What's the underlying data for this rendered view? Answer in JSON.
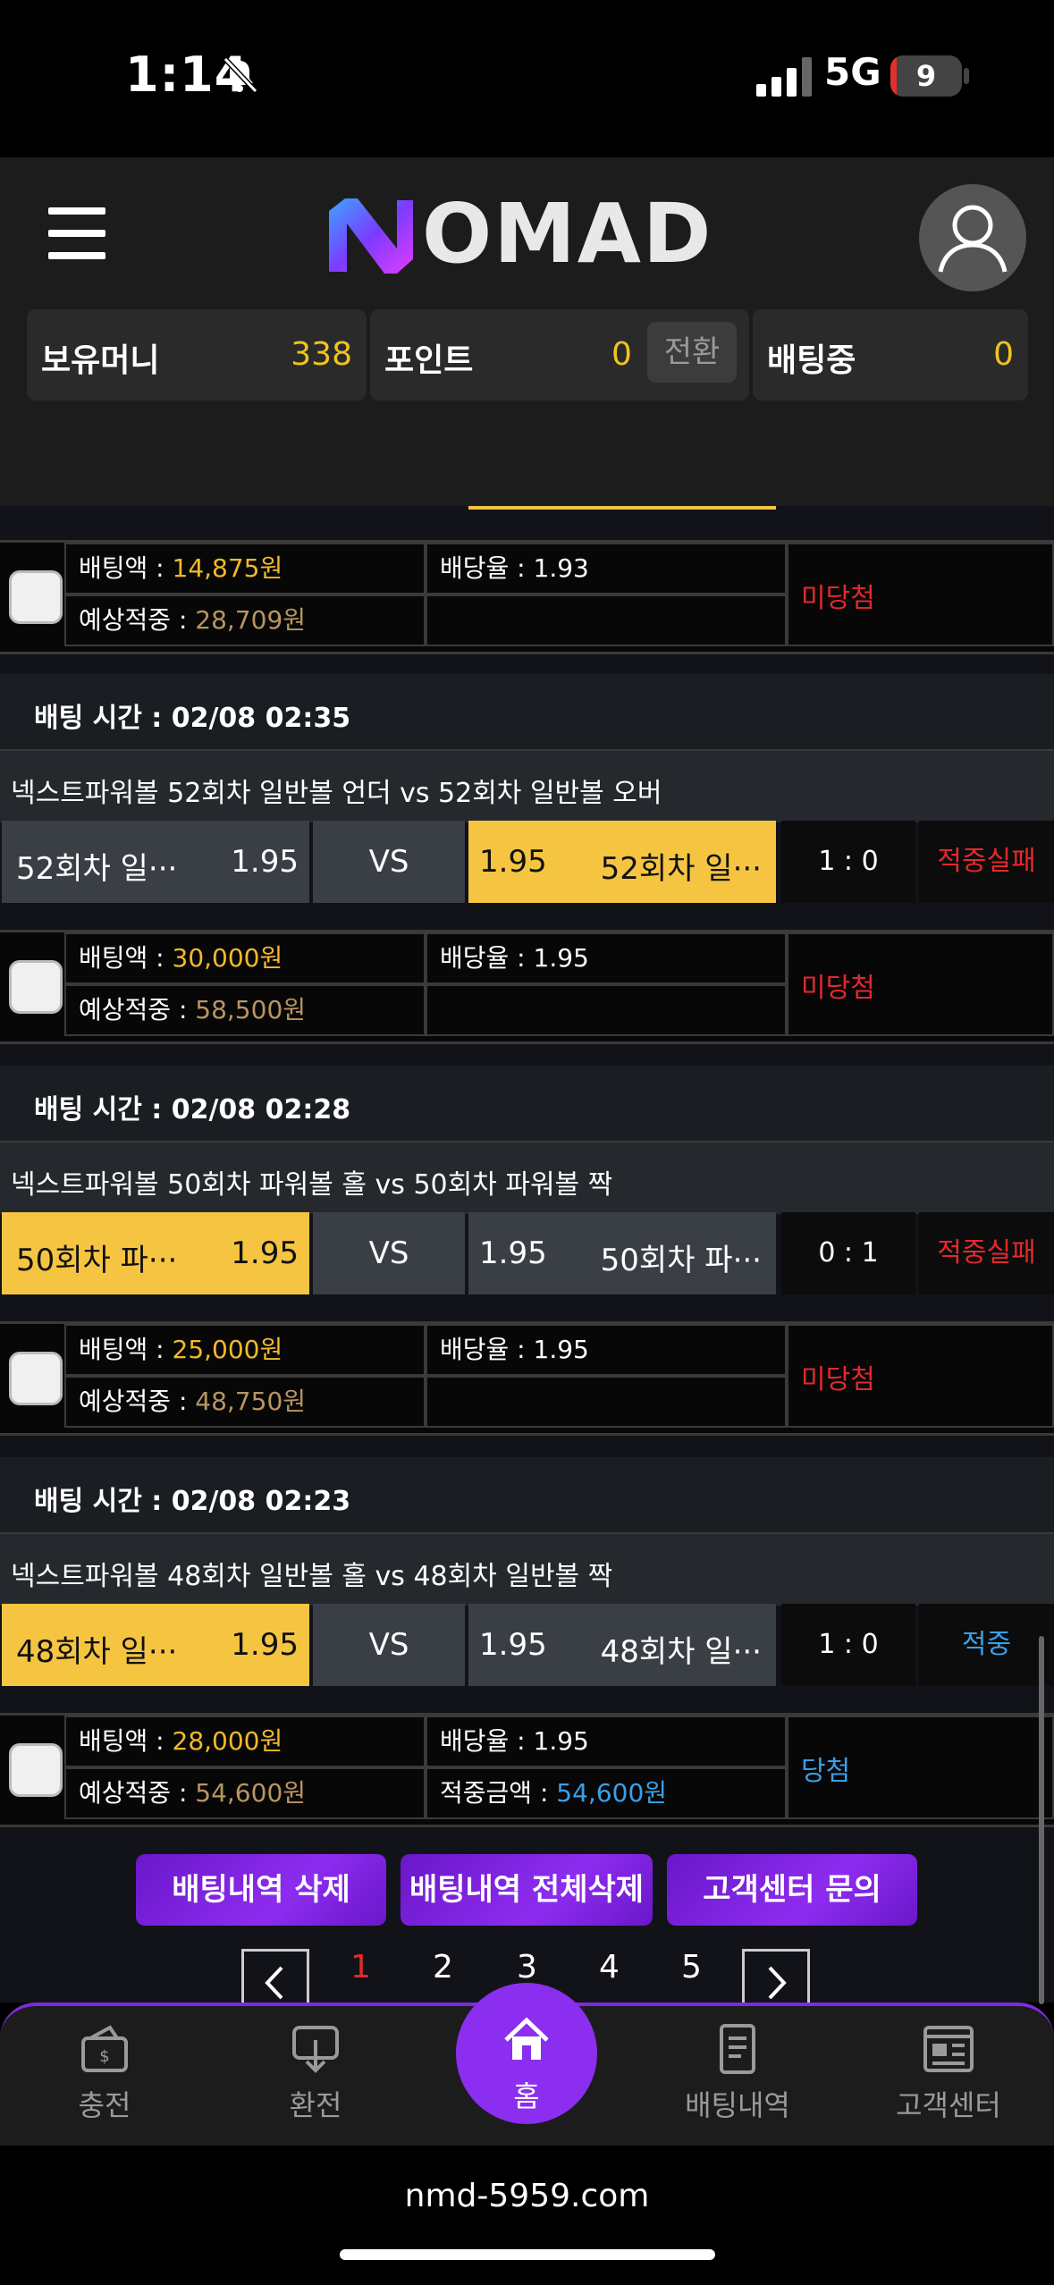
{
  "status_bar": {
    "time": "1:14",
    "network": "5G",
    "battery": "9",
    "battery_level": 0.09
  },
  "header": {
    "logo_text": "OMAD",
    "logo_mark": "N",
    "balance": [
      {
        "label": "보유머니",
        "value": "338"
      },
      {
        "label": "포인트",
        "value": "0",
        "action": "전환"
      },
      {
        "label": "배팅중",
        "value": "0"
      }
    ]
  },
  "bets": [
    {
      "partial": true,
      "bet_amount_label": "배팅액 : ",
      "bet_amount": "14,875원",
      "odds_label": "배당율 : 1.93",
      "expected_label": "예상적중 : ",
      "expected": "28,709원",
      "win_label": "",
      "win_amount": "",
      "state": "미당첨",
      "state_color": "red"
    },
    {
      "time": "배팅 시간 : 02/08 02:35",
      "title": "넥스트파워볼 52회차 일반볼 언더  vs  52회차 일반볼 오버",
      "home_name": "52회차 일···",
      "home_odds": "1.95",
      "vs": "VS",
      "away_odds": "1.95",
      "away_name": "52회차 일···",
      "selected": "away",
      "score": "1 : 0",
      "result": "적중실패",
      "result_color": "red",
      "bet_amount_label": "배팅액 : ",
      "bet_amount": "30,000원",
      "odds_label": "배당율 : 1.95",
      "expected_label": "예상적중 : ",
      "expected": "58,500원",
      "win_label": "",
      "win_amount": "",
      "state": "미당첨",
      "state_color": "red"
    },
    {
      "time": "배팅 시간 : 02/08 02:28",
      "title": "넥스트파워볼 50회차 파워볼 홀  vs  50회차 파워볼 짝",
      "home_name": "50회차 파···",
      "home_odds": "1.95",
      "vs": "VS",
      "away_odds": "1.95",
      "away_name": "50회차 파···",
      "selected": "home",
      "score": "0 : 1",
      "result": "적중실패",
      "result_color": "red",
      "bet_amount_label": "배팅액 : ",
      "bet_amount": "25,000원",
      "odds_label": "배당율 : 1.95",
      "expected_label": "예상적중 : ",
      "expected": "48,750원",
      "win_label": "",
      "win_amount": "",
      "state": "미당첨",
      "state_color": "red"
    },
    {
      "time": "배팅 시간 : 02/08 02:23",
      "title": "넥스트파워볼 48회차 일반볼 홀  vs  48회차 일반볼 짝",
      "home_name": "48회차 일···",
      "home_odds": "1.95",
      "vs": "VS",
      "away_odds": "1.95",
      "away_name": "48회차 일···",
      "selected": "home",
      "score": "1 : 0",
      "result": "적중",
      "result_color": "blue",
      "bet_amount_label": "배팅액 : ",
      "bet_amount": "28,000원",
      "odds_label": "배당율 : 1.95",
      "expected_label": "예상적중 : ",
      "expected": "54,600원",
      "win_label": "적중금액 : ",
      "win_amount": "54,600원",
      "state": "당첨",
      "state_color": "blue"
    }
  ],
  "actions": [
    "배팅내역 삭제",
    "배팅내역 전체삭제",
    "고객센터 문의"
  ],
  "pagination": {
    "pages": [
      "1",
      "2",
      "3",
      "4",
      "5"
    ],
    "current": "1"
  },
  "nav": [
    {
      "label": "충전",
      "icon": "wallet-icon"
    },
    {
      "label": "환전",
      "icon": "exchange-icon"
    },
    {
      "label": "홈",
      "icon": "home-icon"
    },
    {
      "label": "배팅내역",
      "icon": "document-icon"
    },
    {
      "label": "고객센터",
      "icon": "newspaper-icon"
    }
  ],
  "browser": {
    "url": "nmd-5959.com"
  },
  "colors": {
    "accent": "#8b2ef0",
    "selected_pick": "#f5c542",
    "gold": "#f2c31d",
    "fail": "#e5282c",
    "win": "#3aa0e8"
  }
}
